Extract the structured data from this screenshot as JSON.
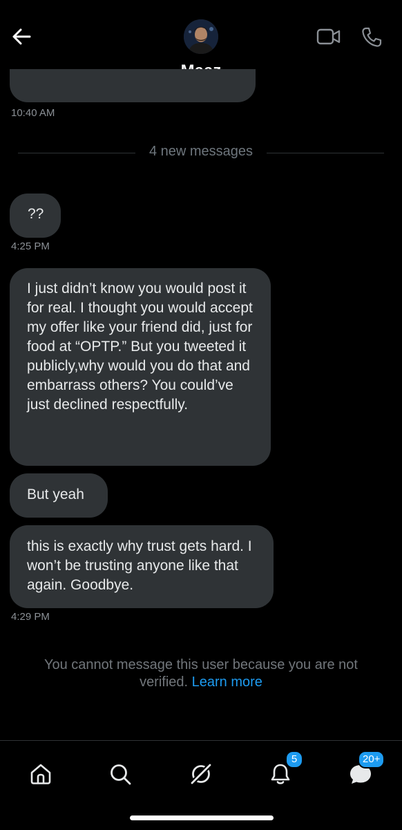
{
  "header": {
    "contact_name": "Maaz",
    "back_icon": "arrow-left-icon",
    "video_icon": "video-camera-icon",
    "phone_icon": "phone-icon"
  },
  "conversation": {
    "previous_time": "10:40 AM",
    "divider_label": "4 new messages",
    "messages": [
      {
        "text": "??"
      },
      {
        "text": "I just didn’t know you would post it for real. I thought you would accept my offer like your friend did, just for food at “OPTP.” But you tweeted it publicly,why would you do that and embarrass others? You could’ve just declined respectfully."
      },
      {
        "text": "But yeah"
      },
      {
        "text": "this is exactly why trust gets hard. I won’t be trusting anyone like that again. Goodbye."
      }
    ],
    "time_1": "4:25 PM",
    "time_2": "4:29 PM"
  },
  "notice": {
    "text": "You cannot message this user because you are not verified.",
    "link": "Learn more"
  },
  "tabbar": {
    "notifications_badge": "5",
    "messages_badge": "20+"
  },
  "colors": {
    "background": "#000000",
    "bubble": "#2f3336",
    "accent": "#1d9bf0",
    "muted_text": "#71767b"
  }
}
